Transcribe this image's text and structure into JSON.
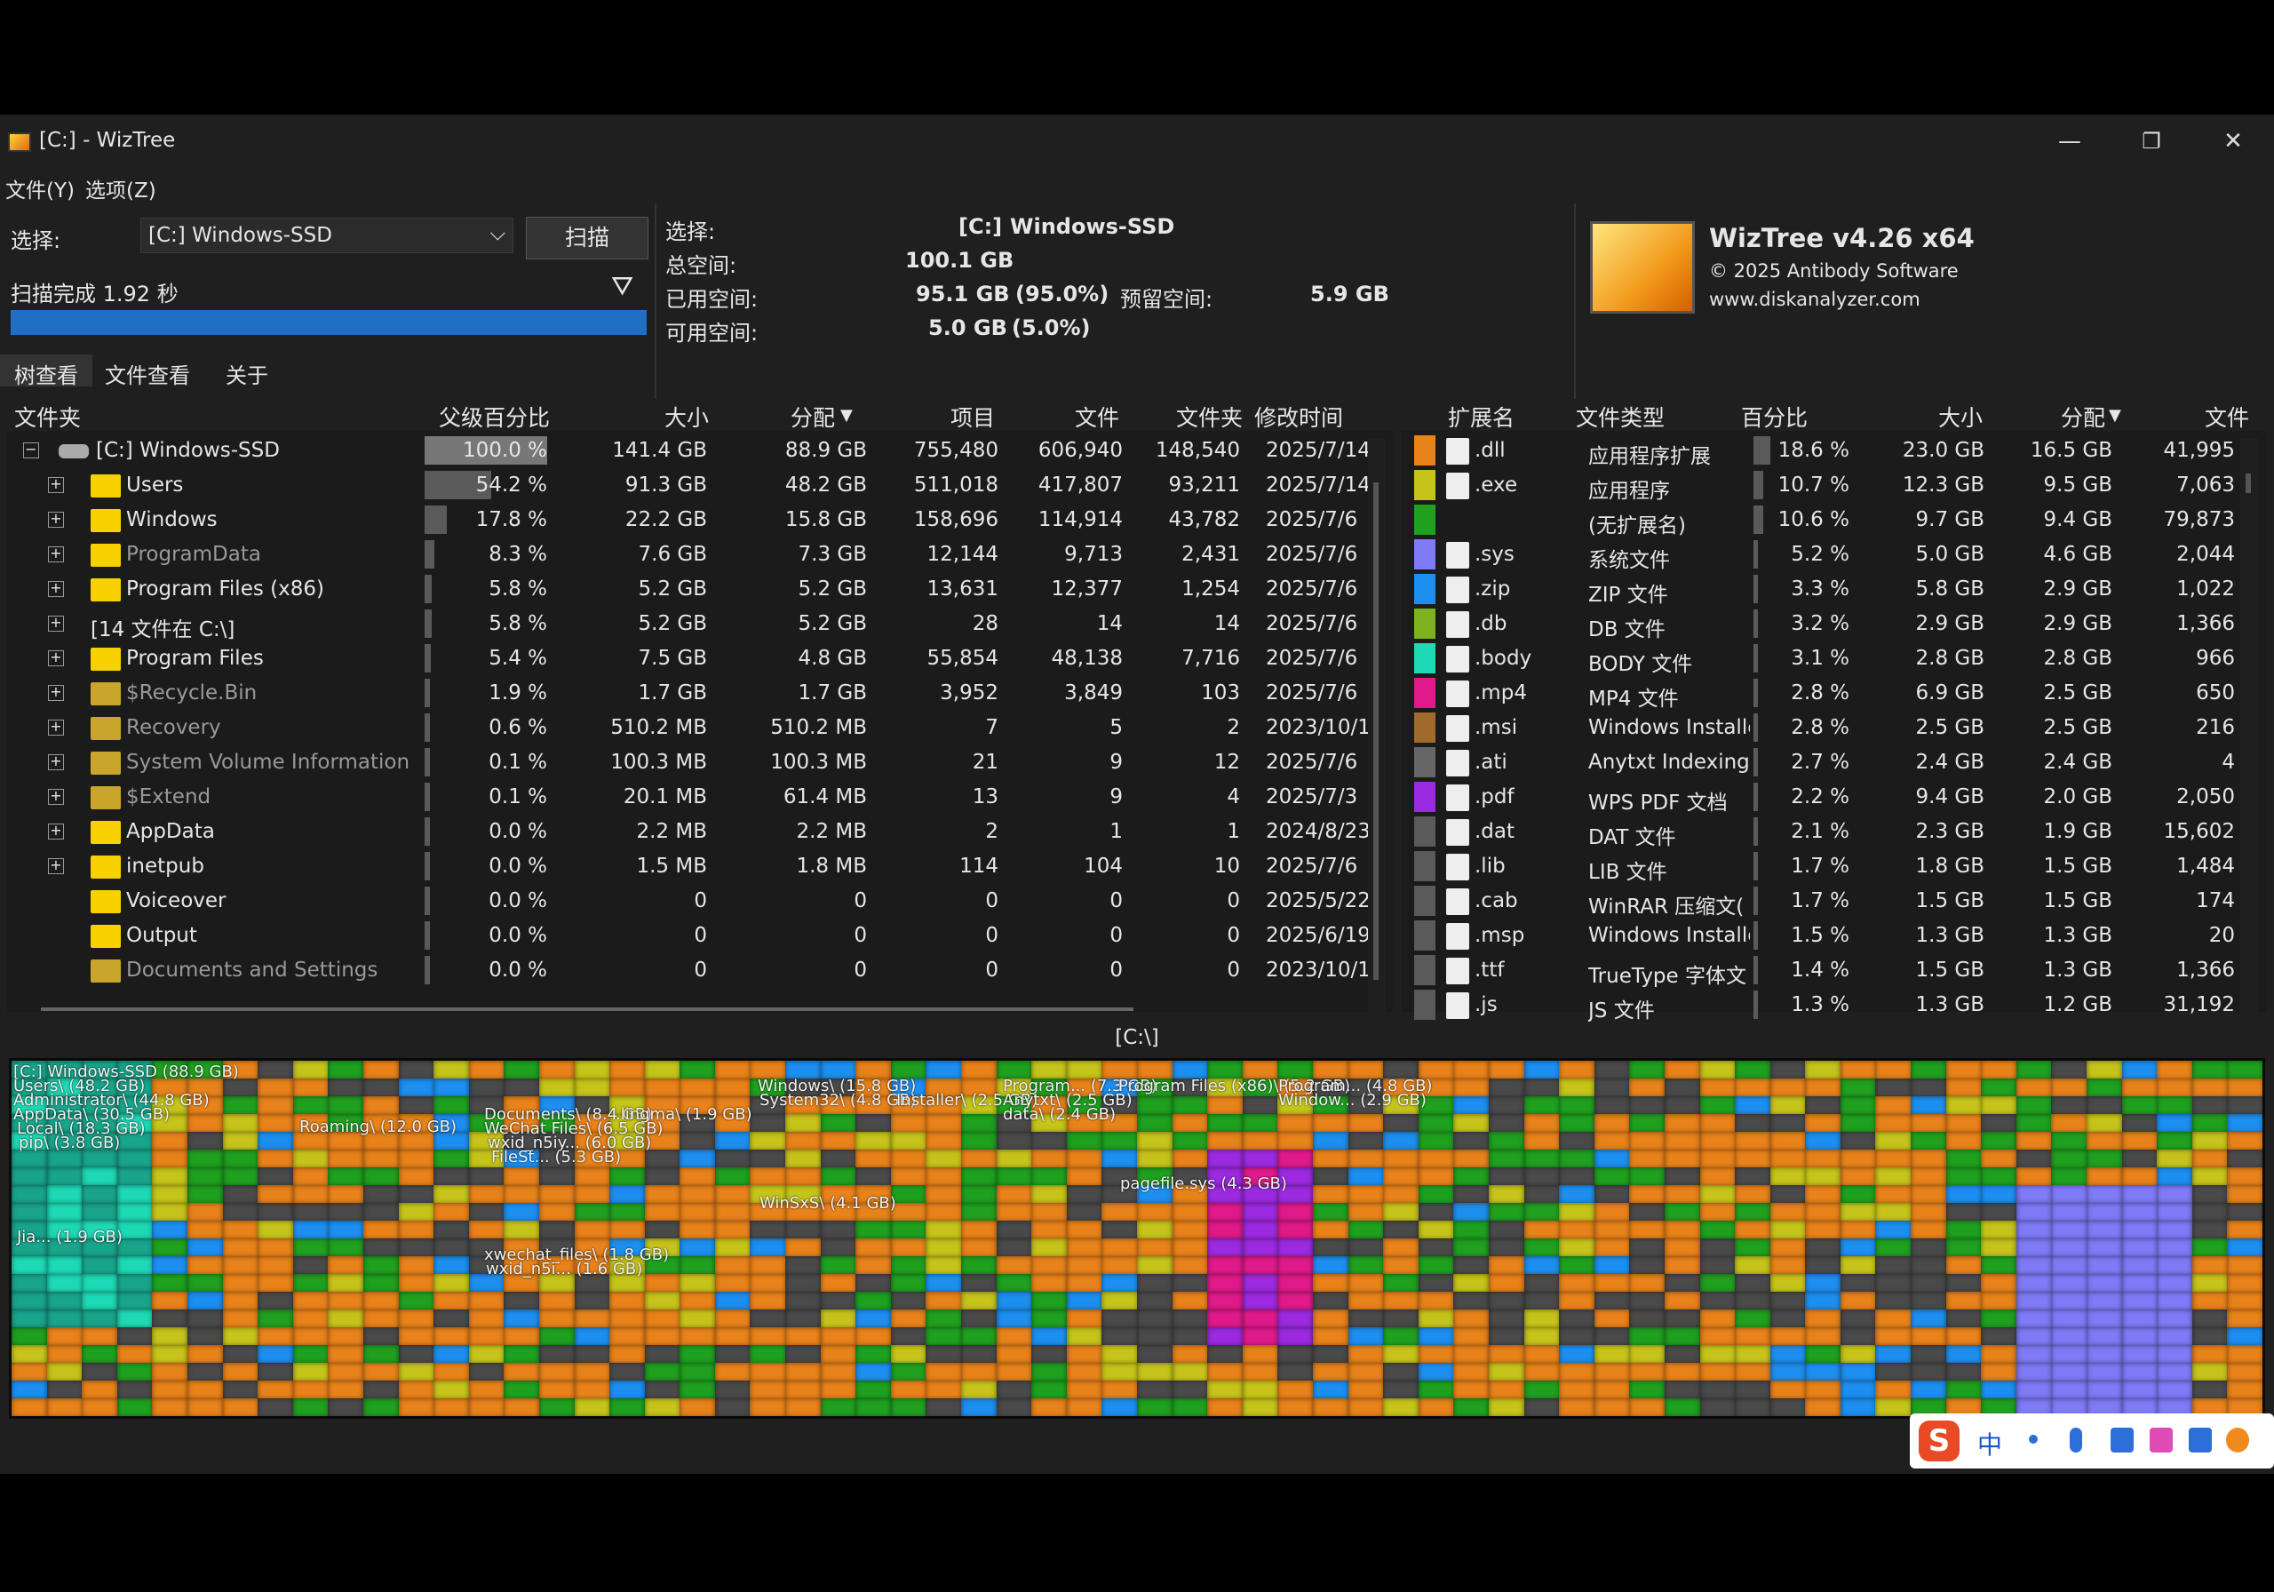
{
  "window": {
    "title": "[C:]  - WizTree",
    "minimize": "—",
    "restore": "❐",
    "close": "✕"
  },
  "menu": [
    "文件(Y)",
    "选项(Z)"
  ],
  "control": {
    "select_label": "选择:",
    "drive_value": "[C:] Windows-SSD",
    "scan_button": "扫描",
    "status": "扫描完成 1.92 秒",
    "progress": 1.0
  },
  "info": {
    "select_label": "选择:",
    "drive_letter": "[C:]",
    "drive_name": "Windows-SSD",
    "total_label": "总空间:",
    "total": "100.1 GB",
    "used_label": "已用空间:",
    "used": "95.1 GB",
    "used_pct": "(95.0%)",
    "reserved_label": "预留空间:",
    "reserved": "5.9 GB",
    "free_label": "可用空间:",
    "free": "5.0 GB",
    "free_pct": "(5.0%)"
  },
  "brand": {
    "name": "WizTree v4.26 x64",
    "copyright": "© 2025 Antibody Software",
    "url": "www.diskanalyzer.com"
  },
  "tabs": [
    "树查看",
    "文件查看",
    "关于"
  ],
  "tree": {
    "headers": [
      "文件夹",
      "父级百分比",
      "大小",
      "分配",
      "项目",
      "文件",
      "文件夹",
      "修改时间"
    ],
    "rows": [
      {
        "name": "[C:] Windows-SSD",
        "pct": "100.0 %",
        "p": 1.0,
        "size": "141.4 GB",
        "alloc": "88.9 GB",
        "items": "755,480",
        "files": "606,940",
        "folders": "148,540",
        "mod": "2025/7/14",
        "icon": "drive",
        "level": 0,
        "exp": "−"
      },
      {
        "name": "Users",
        "pct": "54.2 %",
        "p": 0.542,
        "size": "91.3 GB",
        "alloc": "48.2 GB",
        "items": "511,018",
        "files": "417,807",
        "folders": "93,211",
        "mod": "2025/7/14",
        "icon": "folder",
        "level": 1,
        "exp": "+"
      },
      {
        "name": "Windows",
        "pct": "17.8 %",
        "p": 0.178,
        "size": "22.2 GB",
        "alloc": "15.8 GB",
        "items": "158,696",
        "files": "114,914",
        "folders": "43,782",
        "mod": "2025/7/6",
        "icon": "folder",
        "level": 1,
        "exp": "+"
      },
      {
        "name": "ProgramData",
        "pct": "8.3 %",
        "p": 0.083,
        "size": "7.6 GB",
        "alloc": "7.3 GB",
        "items": "12,144",
        "files": "9,713",
        "folders": "2,431",
        "mod": "2025/7/6",
        "icon": "folder",
        "level": 1,
        "exp": "+",
        "dim": true
      },
      {
        "name": "Program Files (x86)",
        "pct": "5.8 %",
        "p": 0.058,
        "size": "5.2 GB",
        "alloc": "5.2 GB",
        "items": "13,631",
        "files": "12,377",
        "folders": "1,254",
        "mod": "2025/7/6",
        "icon": "folder",
        "level": 1,
        "exp": "+"
      },
      {
        "name": "[14 文件在 C:\\]",
        "pct": "5.8 %",
        "p": 0.058,
        "size": "5.2 GB",
        "alloc": "5.2 GB",
        "items": "28",
        "files": "14",
        "folders": "14",
        "mod": "2025/7/6",
        "icon": "none",
        "level": 1,
        "exp": "+"
      },
      {
        "name": "Program Files",
        "pct": "5.4 %",
        "p": 0.054,
        "size": "7.5 GB",
        "alloc": "4.8 GB",
        "items": "55,854",
        "files": "48,138",
        "folders": "7,716",
        "mod": "2025/7/6",
        "icon": "folder",
        "level": 1,
        "exp": "+"
      },
      {
        "name": "$Recycle.Bin",
        "pct": "1.9 %",
        "p": 0.019,
        "size": "1.7 GB",
        "alloc": "1.7 GB",
        "items": "3,952",
        "files": "3,849",
        "folders": "103",
        "mod": "2025/7/6",
        "icon": "sys",
        "level": 1,
        "exp": "+",
        "dim": true
      },
      {
        "name": "Recovery",
        "pct": "0.6 %",
        "p": 0.006,
        "size": "510.2 MB",
        "alloc": "510.2 MB",
        "items": "7",
        "files": "5",
        "folders": "2",
        "mod": "2023/10/1",
        "icon": "sys",
        "level": 1,
        "exp": "+",
        "dim": true
      },
      {
        "name": "System Volume Information",
        "pct": "0.1 %",
        "p": 0.001,
        "size": "100.3 MB",
        "alloc": "100.3 MB",
        "items": "21",
        "files": "9",
        "folders": "12",
        "mod": "2025/7/6",
        "icon": "sys",
        "level": 1,
        "exp": "+",
        "dim": true
      },
      {
        "name": "$Extend",
        "pct": "0.1 %",
        "p": 0.001,
        "size": "20.1 MB",
        "alloc": "61.4 MB",
        "items": "13",
        "files": "9",
        "folders": "4",
        "mod": "2025/7/3",
        "icon": "sys",
        "level": 1,
        "exp": "+",
        "dim": true
      },
      {
        "name": "AppData",
        "pct": "0.0 %",
        "p": 0.0,
        "size": "2.2 MB",
        "alloc": "2.2 MB",
        "items": "2",
        "files": "1",
        "folders": "1",
        "mod": "2024/8/23",
        "icon": "folder",
        "level": 1,
        "exp": "+"
      },
      {
        "name": "inetpub",
        "pct": "0.0 %",
        "p": 0.0,
        "size": "1.5 MB",
        "alloc": "1.8 MB",
        "items": "114",
        "files": "104",
        "folders": "10",
        "mod": "2025/7/6",
        "icon": "folder",
        "level": 1,
        "exp": "+"
      },
      {
        "name": "Voiceover",
        "pct": "0.0 %",
        "p": 0.0,
        "size": "0",
        "alloc": "0",
        "items": "0",
        "files": "0",
        "folders": "0",
        "mod": "2025/5/22",
        "icon": "folder",
        "level": 1,
        "exp": ""
      },
      {
        "name": "Output",
        "pct": "0.0 %",
        "p": 0.0,
        "size": "0",
        "alloc": "0",
        "items": "0",
        "files": "0",
        "folders": "0",
        "mod": "2025/6/19",
        "icon": "folder",
        "level": 1,
        "exp": ""
      },
      {
        "name": "Documents and Settings",
        "pct": "0.0 %",
        "p": 0.0,
        "size": "0",
        "alloc": "0",
        "items": "0",
        "files": "0",
        "folders": "0",
        "mod": "2023/10/1",
        "icon": "sys",
        "level": 1,
        "exp": "",
        "dim": true
      }
    ]
  },
  "ext": {
    "headers": [
      "扩展名",
      "文件类型",
      "百分比",
      "大小",
      "分配",
      "文件"
    ],
    "rows": [
      {
        "color": "#e8821a",
        "ext": ".dll",
        "type": "应用程序扩展",
        "pct": "18.6 %",
        "p": 0.186,
        "size": "23.0 GB",
        "alloc": "16.5 GB",
        "files": "41,995"
      },
      {
        "color": "#c6c41a",
        "ext": ".exe",
        "type": "应用程序",
        "pct": "10.7 %",
        "p": 0.107,
        "size": "12.3 GB",
        "alloc": "9.5 GB",
        "files": "7,063"
      },
      {
        "color": "#1fa01f",
        "ext": "",
        "type": "(无扩展名)",
        "pct": "10.6 %",
        "p": 0.106,
        "size": "9.7 GB",
        "alloc": "9.4 GB",
        "files": "79,873"
      },
      {
        "color": "#7f7af5",
        "ext": ".sys",
        "type": "系统文件",
        "pct": "5.2 %",
        "p": 0.052,
        "size": "5.0 GB",
        "alloc": "4.6 GB",
        "files": "2,044"
      },
      {
        "color": "#1d8ff0",
        "ext": ".zip",
        "type": "ZIP 文件",
        "pct": "3.3 %",
        "p": 0.033,
        "size": "5.8 GB",
        "alloc": "2.9 GB",
        "files": "1,022"
      },
      {
        "color": "#7cb31f",
        "ext": ".db",
        "type": "DB 文件",
        "pct": "3.2 %",
        "p": 0.032,
        "size": "2.9 GB",
        "alloc": "2.9 GB",
        "files": "1,366"
      },
      {
        "color": "#1ed9b5",
        "ext": ".body",
        "type": "BODY 文件",
        "pct": "3.1 %",
        "p": 0.031,
        "size": "2.8 GB",
        "alloc": "2.8 GB",
        "files": "966"
      },
      {
        "color": "#e01a8a",
        "ext": ".mp4",
        "type": "MP4 文件",
        "pct": "2.8 %",
        "p": 0.028,
        "size": "6.9 GB",
        "alloc": "2.5 GB",
        "files": "650"
      },
      {
        "color": "#a06a2b",
        "ext": ".msi",
        "type": "Windows Installe",
        "pct": "2.8 %",
        "p": 0.028,
        "size": "2.5 GB",
        "alloc": "2.5 GB",
        "files": "216"
      },
      {
        "color": "#666666",
        "ext": ".ati",
        "type": "Anytxt Indexing",
        "pct": "2.7 %",
        "p": 0.027,
        "size": "2.4 GB",
        "alloc": "2.4 GB",
        "files": "4"
      },
      {
        "color": "#9c2ae0",
        "ext": ".pdf",
        "type": "WPS PDF 文档",
        "pct": "2.2 %",
        "p": 0.022,
        "size": "9.4 GB",
        "alloc": "2.0 GB",
        "files": "2,050"
      },
      {
        "color": "#5a5a5a",
        "ext": ".dat",
        "type": "DAT 文件",
        "pct": "2.1 %",
        "p": 0.021,
        "size": "2.3 GB",
        "alloc": "1.9 GB",
        "files": "15,602"
      },
      {
        "color": "#5a5a5a",
        "ext": ".lib",
        "type": "LIB 文件",
        "pct": "1.7 %",
        "p": 0.017,
        "size": "1.8 GB",
        "alloc": "1.5 GB",
        "files": "1,484"
      },
      {
        "color": "#5a5a5a",
        "ext": ".cab",
        "type": "WinRAR 压缩文(",
        "pct": "1.7 %",
        "p": 0.017,
        "size": "1.5 GB",
        "alloc": "1.5 GB",
        "files": "174"
      },
      {
        "color": "#5a5a5a",
        "ext": ".msp",
        "type": "Windows Installe",
        "pct": "1.5 %",
        "p": 0.015,
        "size": "1.3 GB",
        "alloc": "1.3 GB",
        "files": "20"
      },
      {
        "color": "#5a5a5a",
        "ext": ".ttf",
        "type": "TrueType 字体文",
        "pct": "1.4 %",
        "p": 0.014,
        "size": "1.5 GB",
        "alloc": "1.3 GB",
        "files": "1,366"
      },
      {
        "color": "#5a5a5a",
        "ext": ".js",
        "type": "JS 文件",
        "pct": "1.3 %",
        "p": 0.013,
        "size": "1.3 GB",
        "alloc": "1.2 GB",
        "files": "31,192"
      }
    ]
  },
  "treemap": {
    "caption": "[C:\\]",
    "labels": [
      "[C:] Windows-SSD  (88.9 GB)",
      "Users\\ (48.2 GB)",
      "Administrator\\ (44.8 GB)",
      "AppData\\ (30.5 GB)",
      "Local\\ (18.3 GB)",
      "pip\\ (3.8 GB)",
      "Jia... (1.9 GB)",
      "Roaming\\ (12.0 GB)",
      "Documents\\ (8.4 GB)",
      "WeChat Files\\ (6.5 GB)",
      "wxid_n5iy... (6.0 GB)",
      "FileSt... (5.3 GB)",
      "xwechat_files\\ (1.8 GB)",
      "wxid_n5i... (1.6 GB)",
      ".lingma\\ (1.9 GB)",
      "Windows\\ (15.8 GB)",
      "System32\\ (4.8 GB)",
      "WinSxS\\ (4.1 GB)",
      "Installer\\ (2.5 GB)",
      "Program... (7.3 GB)",
      "Anytxt\\ (2.5 GB)",
      "data\\ (2.4 GB)",
      "Program Files (x86)\\ (5.2 GB)",
      "pagefile.sys (4.3 GB)",
      "Program... (4.8 GB)",
      "Window... (2.9 GB)"
    ]
  },
  "ime": {
    "logo": "S",
    "lang": "中"
  }
}
